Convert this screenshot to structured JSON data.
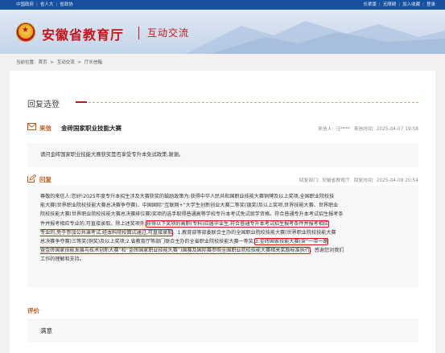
{
  "topbar": {
    "left_links": [
      "中国政府",
      "省人大",
      "省政协"
    ],
    "right_links": [
      "长辈版",
      "无障碍",
      "加入收藏",
      "登录"
    ]
  },
  "header": {
    "site_title": "安徽省教育厅",
    "site_subtitle": "互动交流"
  },
  "breadcrumb": {
    "label": "当前位置:",
    "items": [
      "首页",
      ">",
      "互动交流",
      ">",
      "厅长信箱"
    ]
  },
  "section_title": "回复选登",
  "letter": {
    "tag": "来信",
    "subject": "金砖国家职业技能大赛",
    "sender_label": "来信人:",
    "sender": "汪****",
    "time_label": "来信时间:",
    "time": "2025-04-07 19:58",
    "content": "请问金砖国家职业技能大赛获奖是否享受专升本免试政策,谢谢。"
  },
  "reply": {
    "tag": "回复",
    "dept_label": "回复部门:",
    "dept": "安徽省教育厅",
    "time_label": "回复时间:",
    "time": "2025-04-08 20:54",
    "lines": [
      [
        "尊敬的来信人:您好!2025年度专升本招生涉及大赛获奖的鼓励政策为:获得中华人民共和国职业技能大赛铜牌及以上奖项,全国职业院校技"
      ],
      [
        "能大赛(世界职业院校技能大赛总决赛争夺赛)、中国国际“互联网+”大学生创新创业大赛二等奖(银奖)及以上奖项,世界技能大赛、世界职业"
      ],
      [
        "院校技能大赛(世界职业院校技能大赛总决赛排位赛)奖项的选手取得普通高等学校专升本考试免试就学资格。符合普通专升本考试招生报考条"
      ],
      [
        "件并报考相应专业的,可直接录取。除上述奖项外,",
        "获得以下奖项的高职(专科)应届毕业生,符合普通专升本考试招生报考条件并报考相应"
      ],
      [
        "专业的,免于参加公共课考试,经本科院校面试通过,可直接录取",
        "。1.教育部等部委联合主办的全国职业院校技能大赛(世界职业院校技能大赛"
      ],
      [
        "总决赛争夺赛)三等奖(铜奖)及以上奖项;2.省教育厅等部门联合主办的全省职业院校技能大赛一等奖;",
        "3.金砖国家技能大赛(含“一带一路"
      ],
      [
        "暨金砖国家技能发展与技术创新大赛”和“金砖国家职业技能大赛”)国赛及国际赛参照全国职业院校技能大赛相关奖励标准执行",
        "。感谢您对我们"
      ],
      [
        "工作的理解和支持。"
      ]
    ]
  },
  "evaluation": {
    "title": "评价",
    "value": "满意"
  },
  "colors": {
    "brand_red": "#c4161c",
    "topbar_blue": "#17509e",
    "accent_orange": "#c45a1a",
    "highlight_red": "#d8141c"
  }
}
